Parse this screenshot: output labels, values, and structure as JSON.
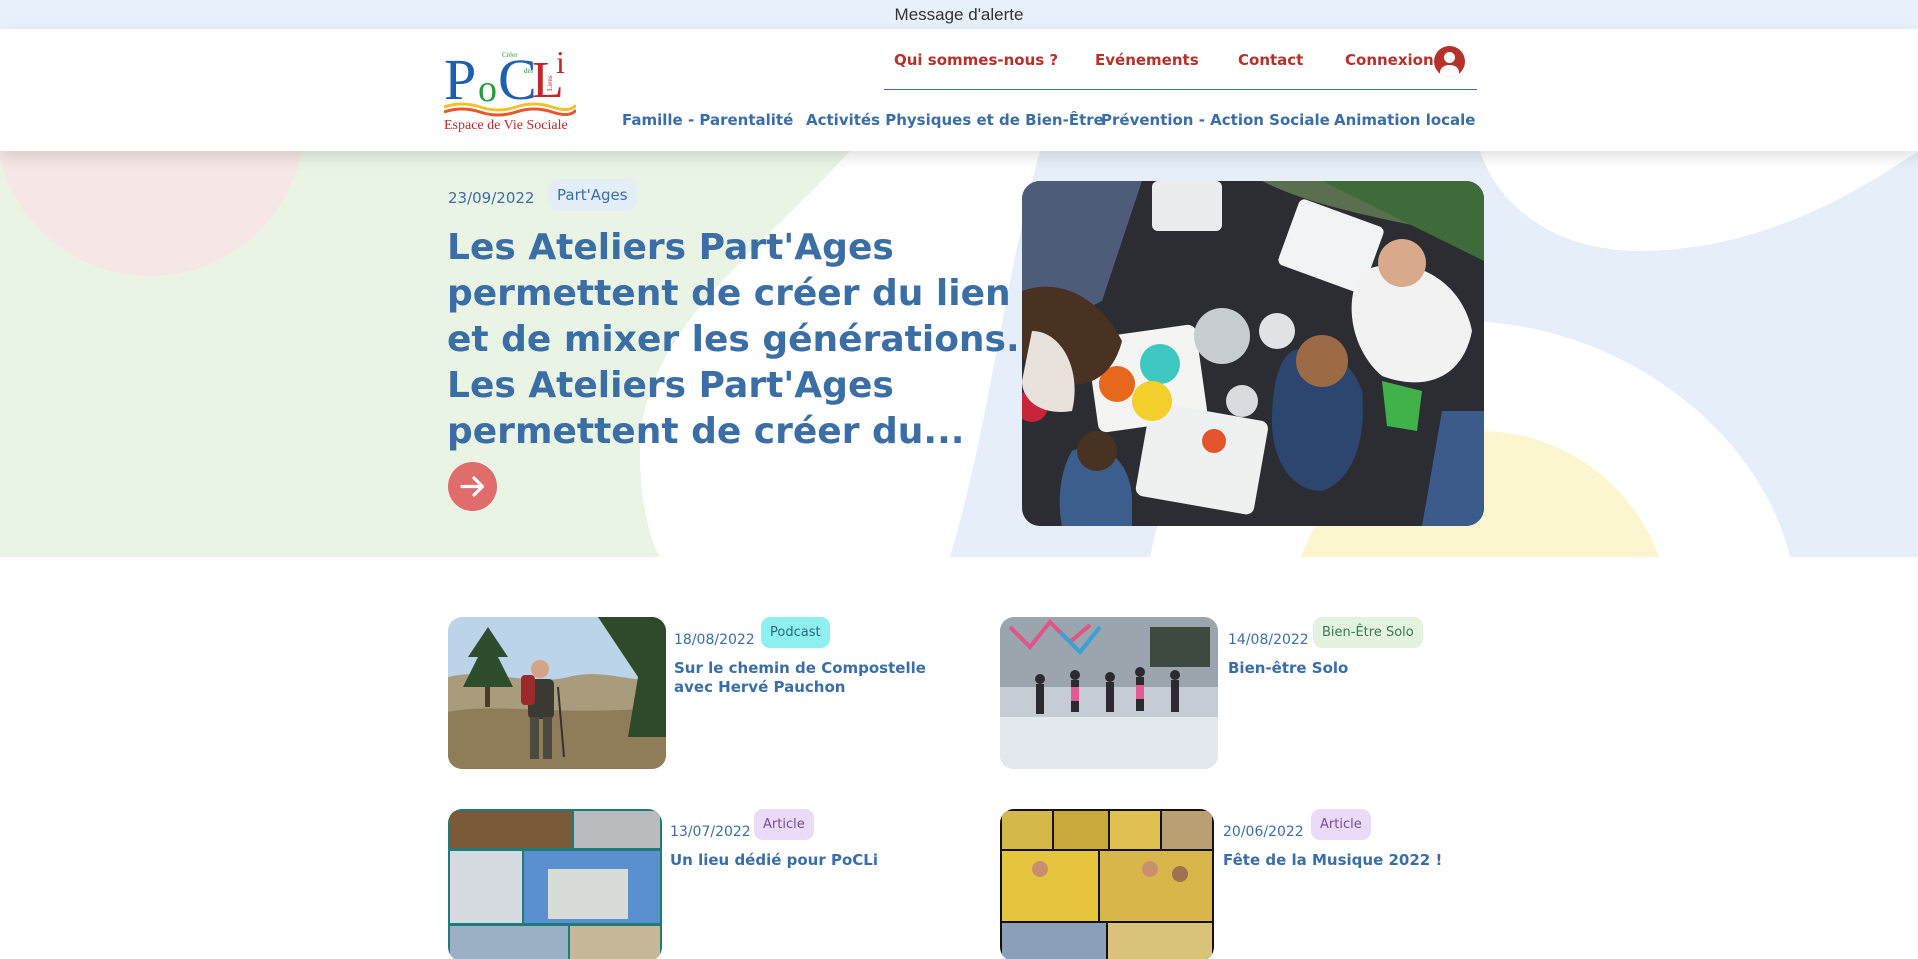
{
  "alert": {
    "text": "Message d'alerte"
  },
  "logo": {
    "letters": [
      "P",
      "o",
      "C",
      "L",
      "i"
    ],
    "small_words": [
      "Pour",
      "Créer",
      "des",
      "Liens"
    ],
    "subtitle": "Espace de Vie Sociale"
  },
  "top_nav": {
    "items": [
      "Qui sommes-nous ?",
      "Evénements",
      "Contact"
    ],
    "login_label": "Connexion"
  },
  "main_nav": {
    "items": [
      "Famille - Parentalité",
      "Activités Physiques et de Bien-Être",
      "Prévention - Action Sociale",
      "Animation locale"
    ]
  },
  "hero": {
    "date": "23/09/2022",
    "tag": "Part'Ages",
    "title": "Les Ateliers Part'Ages permettent de créer du lien et de mixer les générations. Les Ateliers Part'Ages permettent de créer du..."
  },
  "cards": [
    {
      "date": "18/08/2022",
      "tag": "Podcast",
      "title": "Sur le chemin de Compostelle avec Hervé Pauchon"
    },
    {
      "date": "14/08/2022",
      "tag": "Bien-Être Solo",
      "title": "Bien-être Solo"
    },
    {
      "date": "13/07/2022",
      "tag": "Article",
      "title": "Un lieu dédié pour PoCLi"
    },
    {
      "date": "20/06/2022",
      "tag": "Article",
      "title": "Fête de la Musique 2022 !"
    }
  ],
  "colors": {
    "primary_blue": "#3a6ea5",
    "accent_red": "#b5312b",
    "button_red": "#e06c6c",
    "tag_podcast": "#8ff0f0",
    "tag_bienetre": "#e4f3e0",
    "tag_article": "#eadcf8"
  }
}
